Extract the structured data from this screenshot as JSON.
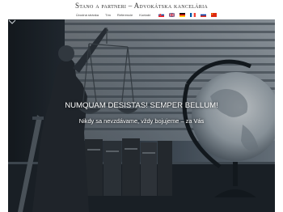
{
  "header": {
    "brand": "Stano a partneri – Advokátska kancelária",
    "nav": [
      "Úvodná stránka",
      "Tím",
      "Referencie",
      "Kontakt"
    ],
    "languages": [
      {
        "code": "sk",
        "icon": "flag-sk-icon"
      },
      {
        "code": "en",
        "icon": "flag-gb-icon"
      },
      {
        "code": "de",
        "icon": "flag-de-icon"
      },
      {
        "code": "fr",
        "icon": "flag-fr-icon"
      },
      {
        "code": "ru",
        "icon": "flag-ru-icon"
      },
      {
        "code": "cn",
        "icon": "flag-cn-icon"
      }
    ]
  },
  "hero": {
    "headline": "NUMQUAM DESISTAS! SEMPER BELLUM!",
    "subline": "Nikdy sa nevzdávame, vždy bojujeme – za Vás",
    "scroll_icon": "chevron-down-icon"
  },
  "colors": {
    "background": "#ffffff",
    "hero_tint": "#2a3440",
    "text_on_hero": "#ffffff"
  }
}
